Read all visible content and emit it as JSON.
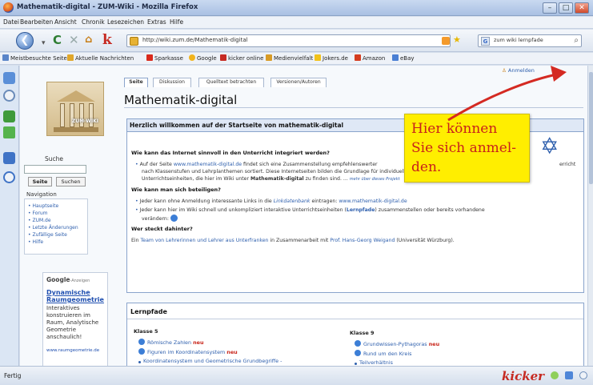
{
  "window": {
    "title": "Mathematik-digital - ZUM-Wiki - Mozilla Firefox"
  },
  "menu": [
    "Datei",
    "Bearbeiten",
    "Ansicht",
    "Chronik",
    "Lesezeichen",
    "Extras",
    "Hilfe"
  ],
  "nav": {
    "url": "http://wiki.zum.de/Mathematik-digital",
    "search_value": "zum wiki lernpfade"
  },
  "bookmarks": [
    "Meistbesuchte Seiten",
    "Aktuelle Nachrichten",
    "Sparkasse",
    "Google",
    "kicker online",
    "Medienvielfalt",
    "Jokers.de",
    "Amazon",
    "eBay"
  ],
  "status": {
    "text": "Fertig",
    "brand": "kicker"
  },
  "sidebar": {
    "logo_text": "ZUM-WIKI",
    "search_heading": "Suche",
    "search_go": "Seite",
    "search_btn": "Suchen",
    "nav_heading": "Navigation",
    "nav_items": [
      "Hauptseite",
      "Forum",
      "ZUM.de",
      "Letzte Änderungen",
      "Zufällige Seite",
      "Hilfe"
    ]
  },
  "ads": {
    "label": "Google",
    "label_small": "-Anzeigen",
    "title": "Dynamische Raumgeometrie",
    "desc": "Interaktives konstruieren im Raum, Analytische Geometrie anschaulich!",
    "url": "www.raumgeometrie.de"
  },
  "tabs": [
    "Seite",
    "Diskussion",
    "Quelltext betrachten",
    "Versionen/Autoren"
  ],
  "login": "Anmelden",
  "page_title": "Mathematik-digital",
  "welcome": {
    "heading": "Herzlich willkommen auf der Startseite von mathematik-digital",
    "q1": "Wie kann das Internet sinnvoll in den Unterricht integriert werden?",
    "p1_a": "Auf der Seite ",
    "p1_link": "www.mathematik-digital.de",
    "p1_b": " findet sich eine Zusammenstellung empfehlenswerter",
    "p1_end": "erricht",
    "p1_line2": "nach Klassenstufen und Lehrplanthemen sortiert. Diese Internetseiten bilden die Grundlage für individuell zusammengestellte interaktive",
    "p1_line3_a": "Unterrichtseinheiten, die hier im Wiki unter ",
    "p1_line3_b": "Mathematik-digital",
    "p1_line3_c": " zu finden sind. ... ",
    "p1_more": "mehr über dieses Projekt",
    "q2": "Wie kann man sich beteiligen?",
    "b2_a": "Jeder kann ohne Anmeldung interessante Links in die ",
    "b2_italic": "Linkdatenbank",
    "b2_b": " eintragen: ",
    "b2_link": "www.mathematik-digital.de",
    "b3_a": "Jeder kann hier im Wiki schnell und unkompliziert interaktive Unterrichtseinheiten (",
    "b3_link": "Lernpfade",
    "b3_b": ") zusammenstellen oder bereits vorhandene",
    "b3_line2": "verändern:",
    "q3": "Wer steckt dahinter?",
    "p3_a": "Ein ",
    "p3_link1": "Team von Lehrerinnen und Lehrer aus Unterfranken",
    "p3_b": " in Zusammenarbeit mit ",
    "p3_link2": "Prof. Hans-Georg Weigand",
    "p3_c": " (Universität Würzburg)."
  },
  "lernpfade": {
    "heading": "Lernpfade",
    "k5": "Klasse 5",
    "k5_items": [
      {
        "t": "Römische Zahlen",
        "n": "neu"
      },
      {
        "t": "Figuren im Koordinatensystem",
        "n": "neu"
      },
      {
        "t": "Koordinatensystem und Geometrische Grundbegriffe -",
        "n": ""
      }
    ],
    "k9": "Klasse 9",
    "k9_items": [
      {
        "t": "Grundwissen-Pythagoras",
        "n": "neu"
      },
      {
        "t": "Rund um den Kreis",
        "n": ""
      },
      {
        "t": "Teilverhältnis",
        "n": ""
      }
    ]
  },
  "callout": {
    "line1": "Hier können",
    "line2": "Sie sich anmel-",
    "line3": "den."
  },
  "colors": {
    "callout_bg": "#ffee00",
    "callout_text": "#c8211b",
    "arrow": "#d42a22",
    "link": "#2e5fad"
  }
}
